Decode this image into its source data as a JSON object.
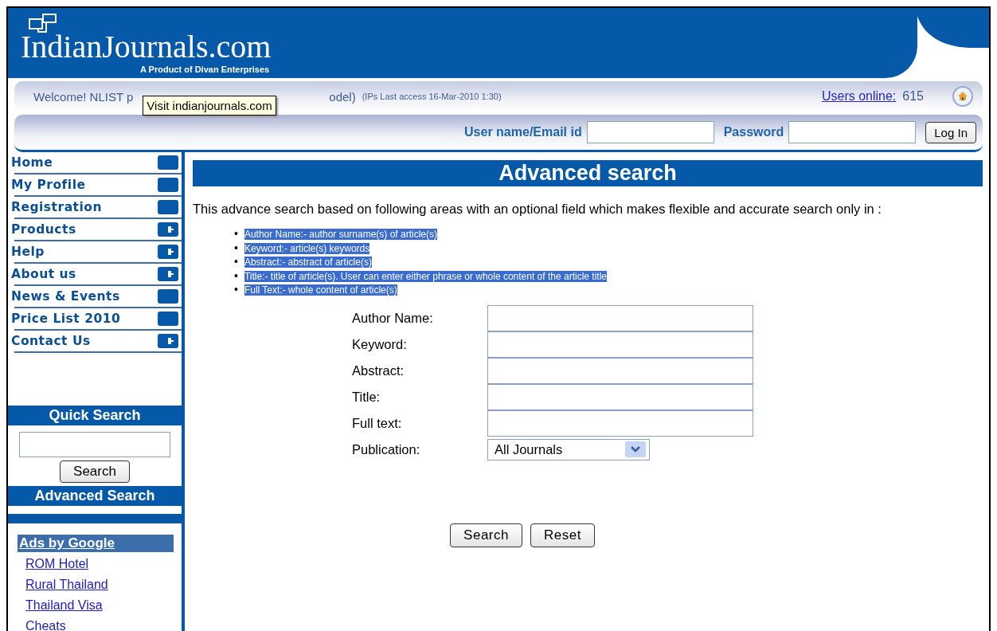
{
  "header": {
    "logo_text": "IndianJournals.com",
    "logo_tagline": "A Product of Divan Enterprises"
  },
  "welcome_bar": {
    "welcome_start": "Welcome! NLIST p",
    "welcome_end": "odel)",
    "last_access": "(IPs Last access 16-Mar-2010 1:30)",
    "users_online_link": "Users online:",
    "users_online_count": "615"
  },
  "tooltip": "Visit indianjournals.com",
  "login_bar": {
    "username_label": "User name/Email id",
    "password_label": "Password",
    "login_button": "Log In"
  },
  "sidebar": {
    "menu": [
      {
        "label": "Home",
        "has_submenu": false
      },
      {
        "label": "My Profile",
        "has_submenu": false
      },
      {
        "label": "Registration",
        "has_submenu": false
      },
      {
        "label": "Products",
        "has_submenu": true
      },
      {
        "label": "Help",
        "has_submenu": true
      },
      {
        "label": "About us",
        "has_submenu": true
      },
      {
        "label": "News & Events",
        "has_submenu": false
      },
      {
        "label": "Price List 2010",
        "has_submenu": false
      },
      {
        "label": "Contact Us",
        "has_submenu": true
      }
    ],
    "quick_search_title": "Quick Search",
    "quick_search_button": "Search",
    "advanced_search_link": "Advanced Search",
    "ads_title": "Ads by Google",
    "ads": [
      "ROM Hotel",
      "Rural Thailand",
      "Thailand Visa",
      "Cheats"
    ]
  },
  "main": {
    "title": "Advanced search",
    "intro": "This advance search based on following areas with an optional field which makes flexible and accurate search only in :",
    "areas_selected": true,
    "areas": [
      {
        "bullet": "•",
        "text": "Author Name:- author surname(s) of article(s)"
      },
      {
        "bullet": "•",
        "text": "Keyword:- article(s) keywords"
      },
      {
        "bullet": "•",
        "text": "Abstract:- abstract of article(s)"
      },
      {
        "bullet": "•",
        "text": "Title:- title of article(s). User can enter either phrase or whole content of the article title"
      },
      {
        "bullet": "•",
        "text": "Full Text:- whole content of article(s)"
      }
    ],
    "fields": [
      {
        "label": "Author Name:",
        "kind": "text"
      },
      {
        "label": "Keyword:",
        "kind": "text"
      },
      {
        "label": "Abstract:",
        "kind": "text"
      },
      {
        "label": "Title:",
        "kind": "text"
      },
      {
        "label": "Full text:",
        "kind": "text"
      },
      {
        "label": "Publication:",
        "kind": "select",
        "value": "All Journals"
      }
    ],
    "buttons": [
      "Search",
      "Reset"
    ]
  }
}
